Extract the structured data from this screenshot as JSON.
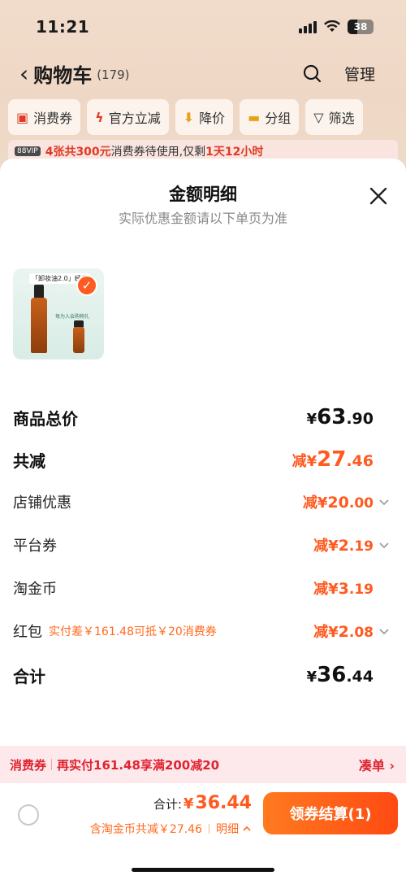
{
  "status": {
    "time": "11:21",
    "battery": "38"
  },
  "nav": {
    "title": "购物车",
    "count": "(179)",
    "manage": "管理"
  },
  "filters": [
    {
      "label": "消费券"
    },
    {
      "label": "官方立减"
    },
    {
      "label": "降价"
    },
    {
      "label": "分组"
    },
    {
      "label": "筛选"
    }
  ],
  "banner": {
    "vip": "88VIP",
    "highlight": "4张共300元",
    "text1": "消费券待使用,仅剩",
    "time": "1天12小时"
  },
  "sheet": {
    "title": "金额明细",
    "subtitle": "实际优惠金额请以下单页为准",
    "product_tag": "「卸妆油2.0」经典",
    "product_sub": "每为入会购物礼"
  },
  "rows": {
    "subtotal": {
      "label": "商品总价",
      "yen": "¥",
      "int": "63",
      "dec": ".90"
    },
    "discount_total": {
      "label": "共减",
      "prefix": "减¥",
      "int": "27",
      "dec": ".46"
    },
    "shop": {
      "label": "店铺优惠",
      "prefix": "减¥",
      "int": "20",
      "dec": ".00"
    },
    "platform": {
      "label": "平台券",
      "prefix": "减¥",
      "int": "2",
      "dec": ".19"
    },
    "coins": {
      "label": "淘金币",
      "prefix": "减¥",
      "int": "3",
      "dec": ".19"
    },
    "redpacket": {
      "label": "红包",
      "note": "实付差￥161.48可抵￥20消费券",
      "prefix": "减¥",
      "int": "2",
      "dec": ".08"
    },
    "total": {
      "label": "合计",
      "yen": "¥",
      "int": "36",
      "dec": ".44"
    }
  },
  "promo": {
    "key": "消费券",
    "message": "再实付161.48享满200减20",
    "action": "凑单 ›"
  },
  "footer": {
    "total_label": "合计:",
    "yen": "¥",
    "amount": "36.44",
    "savings": "含淘金币共减￥27.46",
    "detail": "明细",
    "pay_button": "领券结算(1)"
  },
  "colors": {
    "accent": "#ff5a1f",
    "promo_red": "#e0232f"
  }
}
